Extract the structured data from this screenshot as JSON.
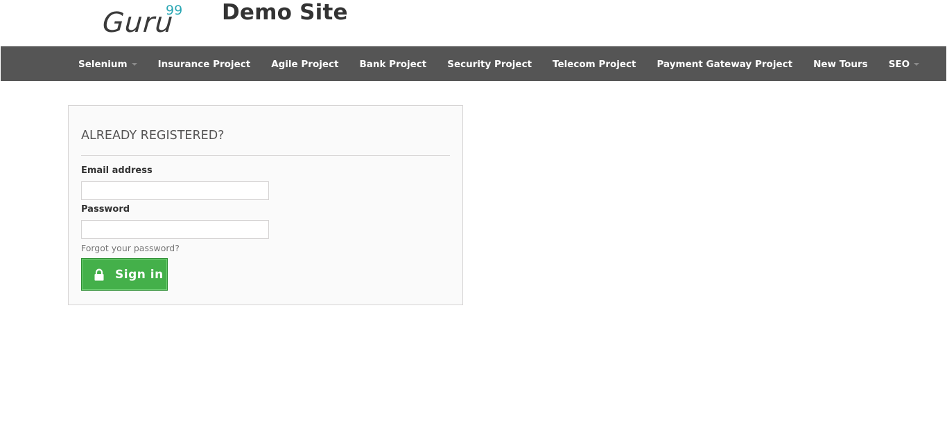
{
  "header": {
    "logo_text": "Guru",
    "logo_sup": "99",
    "site_title": "Demo Site"
  },
  "nav": {
    "items": [
      {
        "label": "Selenium",
        "has_dropdown": true
      },
      {
        "label": "Insurance Project",
        "has_dropdown": false
      },
      {
        "label": "Agile Project",
        "has_dropdown": false
      },
      {
        "label": "Bank Project",
        "has_dropdown": false
      },
      {
        "label": "Security Project",
        "has_dropdown": false
      },
      {
        "label": "Telecom Project",
        "has_dropdown": false
      },
      {
        "label": "Payment Gateway Project",
        "has_dropdown": false
      },
      {
        "label": "New Tours",
        "has_dropdown": false
      },
      {
        "label": "SEO",
        "has_dropdown": true
      }
    ],
    "background": "#555555"
  },
  "login": {
    "heading": "ALREADY REGISTERED?",
    "email_label": "Email address",
    "email_value": "",
    "password_label": "Password",
    "password_value": "",
    "forgot_link": "Forgot your password?",
    "signin_label": "Sign in",
    "signin_icon": "lock-icon",
    "button_color": "#44b04a"
  }
}
